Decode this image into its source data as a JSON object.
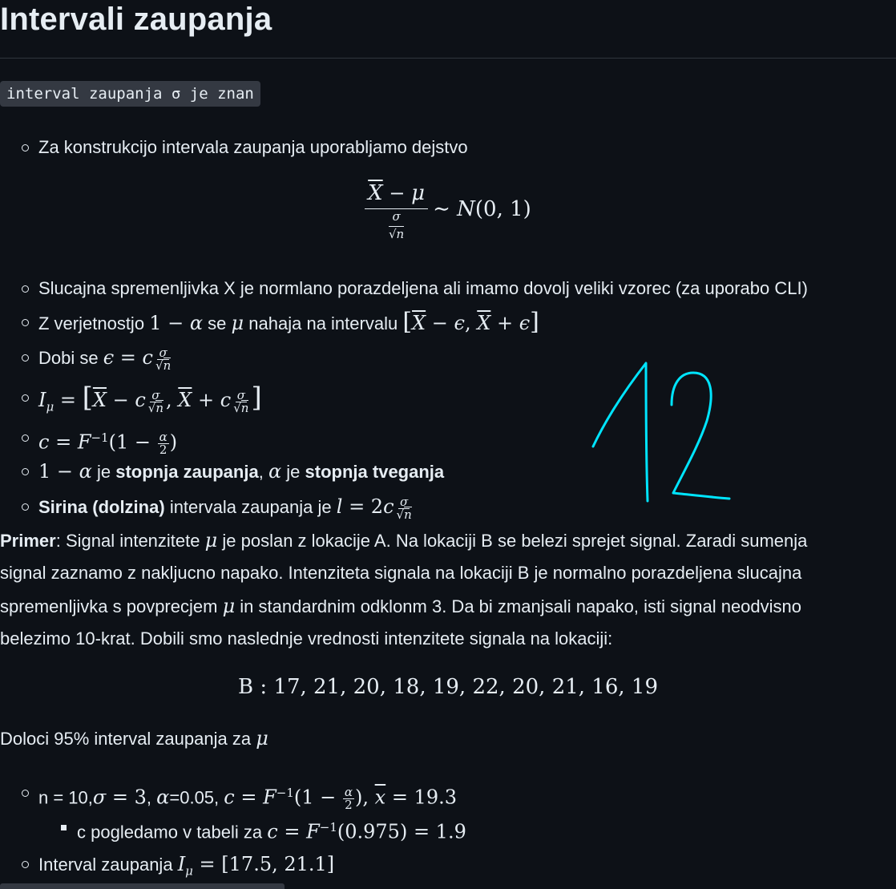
{
  "heading": "Intervali zaupanja",
  "code_label": "interval zaupanja σ je znan",
  "bullets": {
    "b1": "Za konstrukcijo intervala zaupanja uporabljamo dejstvo",
    "b2": "Slucajna spremenljivka X je normlano porazdeljena ali imamo dovolj veliki vzorec (za uporabo CLI)",
    "b3_pre": "Z verjetnostjo",
    "b3_mid1": "se",
    "b3_mid2": "nahaja na intervalu",
    "b4_pre": "Dobi se",
    "b6_pre": "",
    "b7_je1": "je",
    "b7_bold1": "stopnja zaupanja",
    "b7_je2": "je",
    "b7_bold2": "stopnja tveganja",
    "b8_bold": "Sirina (dolzina)",
    "b8_text": "intervala zaupanja je"
  },
  "example": {
    "label": "Primer",
    "line1a": ": Signal intenzitete",
    "line1b": "je poslan z lokacije A. Na lokaciji B se belezi sprejet signal. Zaradi sumenja",
    "line2": "signal zaznamo z nakljucno napako. Intenziteta signala na lokaciji B je normalno porazdeljena slucajna",
    "line3a": "spremenljivka s povprecjem",
    "line3b": "in standardnim odklonm 3. Da bi zmanjsali napako, isti signal neodvisno",
    "line4": "belezimo 10-krat. Dobili smo naslednje vrednosti intenzitete signala na lokaciji:",
    "data_line": "B : 17, 21, 20, 18, 19, 22, 20, 21, 16, 19",
    "question_a": "Doloci 95% interval zaupanja za"
  },
  "solution": {
    "s1_a": "n = 10,",
    "s1_b": ", ",
    "s1_c": "=0.05, ",
    "s2_text": "c pogledamo v tabeli za",
    "s3_text": "Interval zaupanja"
  },
  "handwriting": "12",
  "colors": {
    "background": "#0d1117",
    "text": "#e6edf3",
    "code_bg": "#343942",
    "handwriting": "#00e5ff"
  }
}
